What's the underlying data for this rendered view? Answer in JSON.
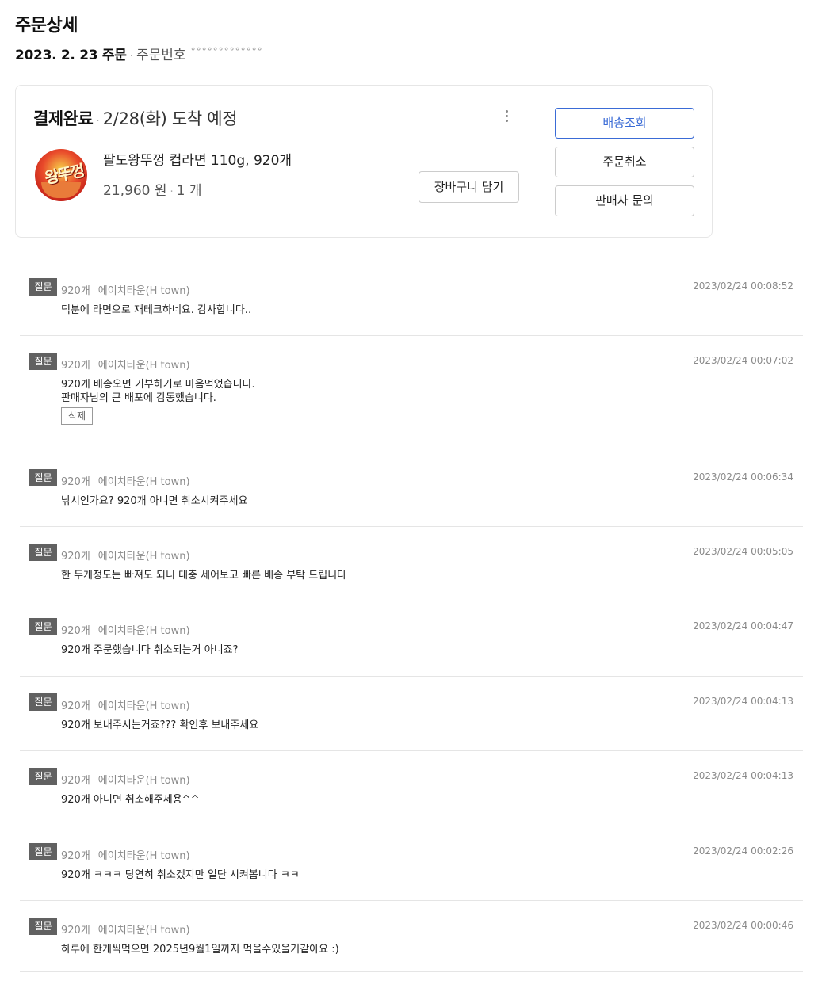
{
  "page": {
    "title": "주문상세",
    "order_date": "2023. 2. 23 주문",
    "order_no_label": "주문번호",
    "order_no_value": "°°°°°°°°°°°°°"
  },
  "order": {
    "status": "결제완료",
    "eta": "2/28(화) 도착 예정",
    "product_name": "팔도왕뚜껑 컵라면 110g, 920개",
    "price": "21,960 원",
    "quantity": "1 개",
    "thumbnail_text": "왕뚜껑",
    "cart_button": "장바구니 담기",
    "track_button": "배송조회",
    "cancel_button": "주문취소",
    "inquiry_button": "판매자 문의",
    "accent_color": "#3a6bd6"
  },
  "qa": {
    "badge": "질문",
    "delete_label": "삭제",
    "items": [
      {
        "option": "920개",
        "seller": "에이치타운(H town)",
        "time": "2023/02/24 00:08:52",
        "lines": [
          "덕분에 라면으로 재테크하네요. 감사합니다.."
        ]
      },
      {
        "option": "920개",
        "seller": "에이치타운(H town)",
        "time": "2023/02/24 00:07:02",
        "lines": [
          "920개 배송오면 기부하기로 마음먹었습니다.",
          "판매자님의 큰 배포에 감동했습니다."
        ],
        "deletable": true
      },
      {
        "option": "920개",
        "seller": "에이치타운(H town)",
        "time": "2023/02/24 00:06:34",
        "lines": [
          "낚시인가요? 920개 아니면 취소시켜주세요"
        ]
      },
      {
        "option": "920개",
        "seller": "에이치타운(H town)",
        "time": "2023/02/24 00:05:05",
        "lines": [
          "한 두개정도는 빠져도 되니 대충 세어보고 빠른 배송 부탁 드립니다"
        ]
      },
      {
        "option": "920개",
        "seller": "에이치타운(H town)",
        "time": "2023/02/24 00:04:47",
        "lines": [
          "920개 주문했습니다 취소되는거 아니죠?"
        ]
      },
      {
        "option": "920개",
        "seller": "에이치타운(H town)",
        "time": "2023/02/24 00:04:13",
        "lines": [
          "920개 보내주시는거죠??? 확인후 보내주세요"
        ]
      },
      {
        "option": "920개",
        "seller": "에이치타운(H town)",
        "time": "2023/02/24 00:04:13",
        "lines": [
          "920개 아니면 취소해주세용^^"
        ]
      },
      {
        "option": "920개",
        "seller": "에이치타운(H town)",
        "time": "2023/02/24 00:02:26",
        "lines": [
          "920개 ㅋㅋㅋ 당연히 취소겠지만 일단 시켜봅니다 ㅋㅋ"
        ]
      },
      {
        "option": "920개",
        "seller": "에이치타운(H town)",
        "time": "2023/02/24 00:00:46",
        "lines": [
          "하루에 한개씩먹으면 2025년9월1일까지 먹을수있을거같아요 :)"
        ]
      }
    ]
  }
}
